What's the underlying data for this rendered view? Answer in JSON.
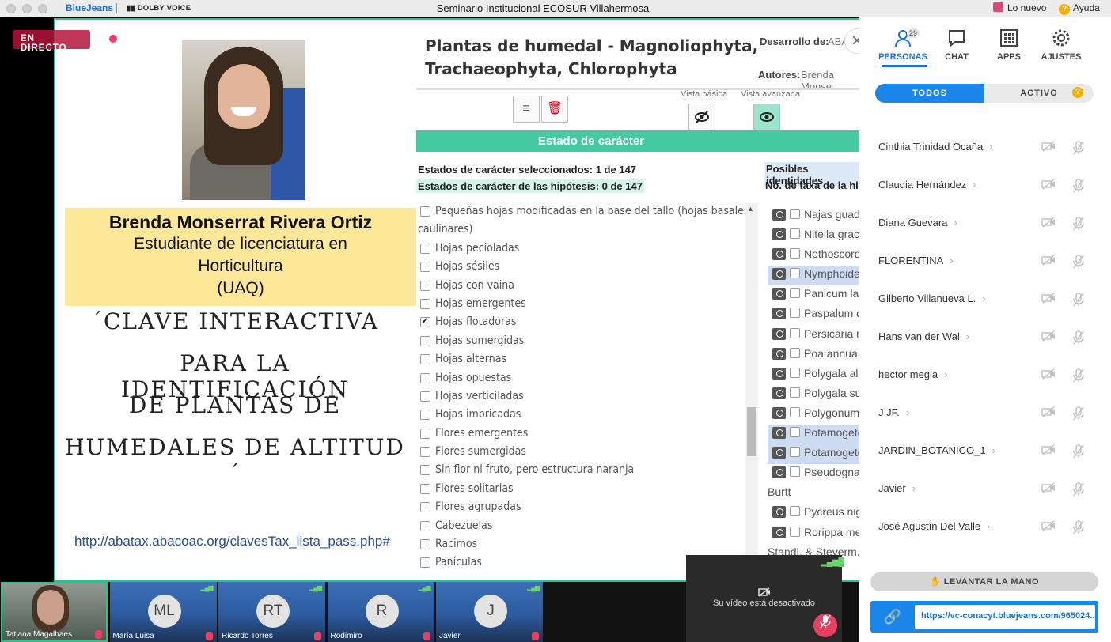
{
  "titlebar": {
    "brand": "BlueJeans",
    "partner": "DOLBY VOICE",
    "meeting_title": "Seminario Institucional ECOSUR Villahermosa",
    "whats_new": "Lo nuevo",
    "help": "Ayuda"
  },
  "stage": {
    "live_badge": "EN DIRECTO"
  },
  "slide": {
    "speaker_name": "Brenda Monserrat Rivera Ortiz",
    "speaker_role_1": "Estudiante de licenciatura en",
    "speaker_role_2": "Horticultura",
    "speaker_affil": "(UAQ)",
    "title_line_1": "´CLAVE INTERACTIVA",
    "title_line_2": "PARA LA IDENTIFICACIÓN",
    "title_line_3": "DE PLANTAS DE",
    "title_line_4": "HUMEDALES DE ALTITUD´",
    "url": "http://abatax.abacoac.org/clavesTax_lista_pass.php#"
  },
  "key": {
    "title_1": "Plantas de humedal - Magnoliophyta,",
    "title_2": "Trachaeophyta, Chlorophyta",
    "dev_label": "Desarrollo de:",
    "dev_value": "ABA",
    "authors_label": "Autores:",
    "authors_value": "Brenda Monse",
    "view_basic": "Vista básica",
    "view_advanced": "Vista avanzada",
    "state_header": "Estado de carácter",
    "selected_count": "Estados de carácter seleccionados: 1 de 147",
    "hypothesis_count": "Estados de carácter de las hipótesis: 0 de 147",
    "possible_ids": "Posibles identidades",
    "taxa_count": "No. de taxa de la hi",
    "characters": [
      {
        "label": "Pequeñas hojas modificadas en la base del tallo (hojas basales o",
        "checked": false
      },
      {
        "label": "caulinares)",
        "checked": false,
        "cont": true
      },
      {
        "label": "Hojas pecioladas",
        "checked": false
      },
      {
        "label": "Hojas sésiles",
        "checked": false
      },
      {
        "label": "Hojas con vaina",
        "checked": false
      },
      {
        "label": "Hojas emergentes",
        "checked": false
      },
      {
        "label": "Hojas flotadoras",
        "checked": true
      },
      {
        "label": "Hojas sumergidas",
        "checked": false
      },
      {
        "label": "Hojas alternas",
        "checked": false
      },
      {
        "label": "Hojas opuestas",
        "checked": false
      },
      {
        "label": "Hojas verticiladas",
        "checked": false
      },
      {
        "label": "Hojas imbricadas",
        "checked": false
      },
      {
        "label": "Flores emergentes",
        "checked": false
      },
      {
        "label": "Flores sumergidas",
        "checked": false
      },
      {
        "label": "Sin flor ni fruto, pero estructura naranja",
        "checked": false
      },
      {
        "label": "Flores solitarias",
        "checked": false
      },
      {
        "label": "Flores agrupadas",
        "checked": false
      },
      {
        "label": "Cabezuelas",
        "checked": false
      },
      {
        "label": "Racimos",
        "checked": false
      },
      {
        "label": "Panículas",
        "checked": false
      }
    ],
    "taxa": [
      {
        "label": "Najas guada",
        "hl": false
      },
      {
        "label": "Nitella graci",
        "hl": false
      },
      {
        "label": "Nothoscord",
        "hl": false
      },
      {
        "label": "Nymphoides",
        "hl": true
      },
      {
        "label": "Panicum lac",
        "hl": false
      },
      {
        "label": "Paspalum di",
        "hl": false
      },
      {
        "label": "Persicaria m",
        "hl": false
      },
      {
        "label": "Poa annua L",
        "hl": false
      },
      {
        "label": "Polygala alb",
        "hl": false
      },
      {
        "label": "Polygala sub",
        "hl": false
      },
      {
        "label": "Polygonum p",
        "hl": false
      },
      {
        "label": "Potamogeto",
        "hl": true
      },
      {
        "label": "Potamogeto",
        "hl": true
      },
      {
        "label": "Pseudognap",
        "hl": false
      },
      {
        "label": "Burtt",
        "hl": false,
        "plain": true
      },
      {
        "label": "Pycreus nige",
        "hl": false
      },
      {
        "label": "Rorippa mex",
        "hl": false
      },
      {
        "label": "Standl. & Steyerm.",
        "hl": false,
        "plain": true
      }
    ]
  },
  "panel": {
    "tabs": [
      {
        "label": "PERSONAS",
        "icon": "people-icon"
      },
      {
        "label": "CHAT",
        "icon": "chat-icon"
      },
      {
        "label": "APPS",
        "icon": "apps-icon"
      },
      {
        "label": "AJUSTES",
        "icon": "gear-icon"
      }
    ],
    "people_count": "29",
    "filter_all": "TODOS",
    "filter_active": "ACTIVO",
    "participants": [
      "Cinthia Trinidad Ocaña",
      "Claudia Hernández",
      "Diana Guevara",
      "FLORENTINA",
      "Gilberto Villanueva L.",
      "Hans van der Wal",
      "hector megia",
      "J JF.",
      "JARDIN_BOTANICO_1",
      "Javier",
      "José Agustín Del Valle"
    ],
    "raise_hand": "LEVANTAR LA MANO",
    "meeting_link": "https://vc-conacyt.bluejeans.com/965024..."
  },
  "strip": {
    "tiles": [
      {
        "name": "Tatiana Magalhaes",
        "initials": "",
        "self": true
      },
      {
        "name": "María Luisa",
        "initials": "ML"
      },
      {
        "name": "Ricardo Torres",
        "initials": "RT"
      },
      {
        "name": "Rodimiro",
        "initials": "R"
      },
      {
        "name": "Javier",
        "initials": "J"
      }
    ],
    "my_video_off": "Su vídeo está desactivado"
  },
  "colors": {
    "accent": "#1a86e8",
    "stage_border": "#2bc38b",
    "live": "#b4143c",
    "mute": "#e84060"
  }
}
